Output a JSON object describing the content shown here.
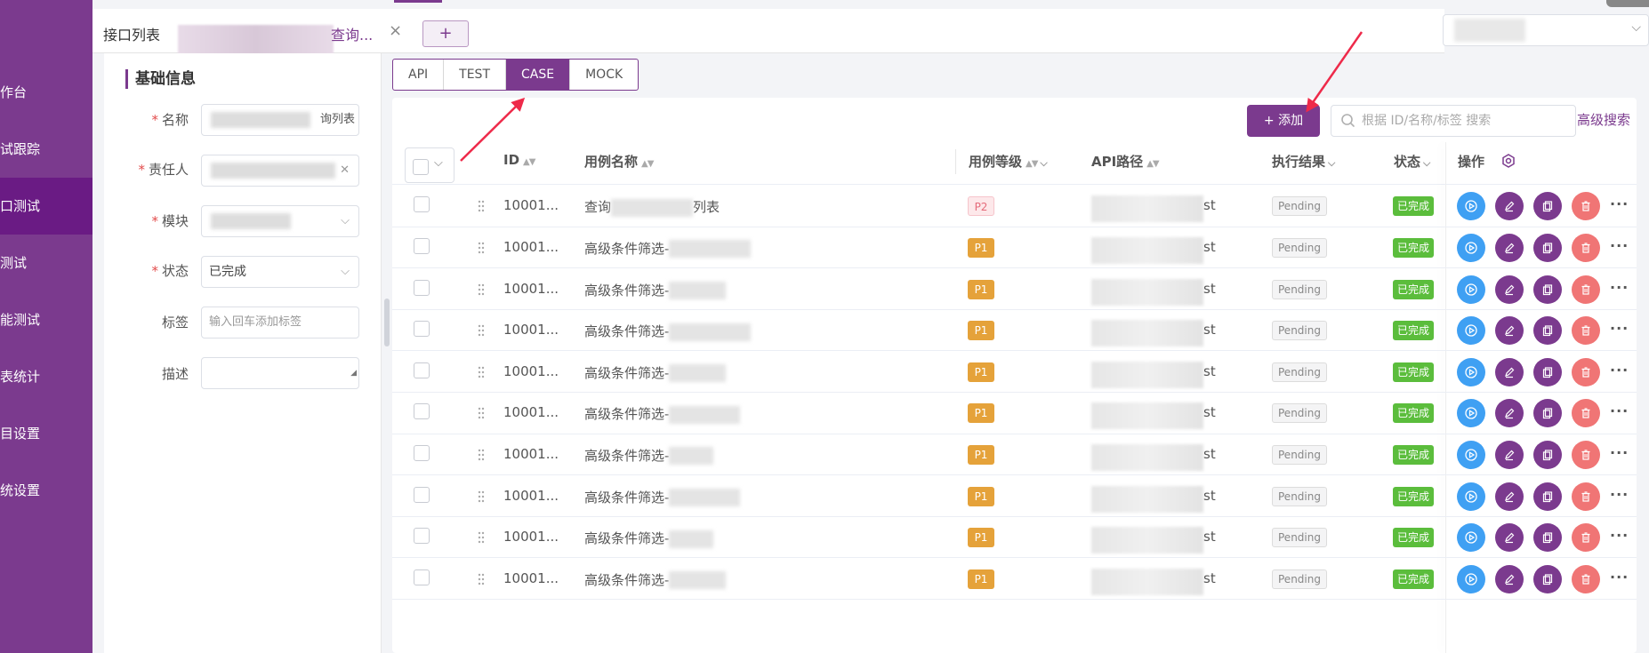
{
  "sidebar": {
    "items": [
      {
        "label": "作台",
        "active": false
      },
      {
        "label": "试跟踪",
        "active": false
      },
      {
        "label": "口测试",
        "active": true
      },
      {
        "label": "测试",
        "active": false
      },
      {
        "label": "能测试",
        "active": false
      },
      {
        "label": "表统计",
        "active": false
      },
      {
        "label": "目设置",
        "active": false
      },
      {
        "label": "统设置",
        "active": false
      }
    ]
  },
  "tabs": {
    "main_label": "接口列表",
    "active_label": "查询...",
    "close_glyph": "×",
    "add_glyph": "+"
  },
  "form": {
    "section_title": "基础信息",
    "fields": {
      "name": {
        "label": "名称",
        "value_suffix": "询列表"
      },
      "owner": {
        "label": "责任人"
      },
      "module": {
        "label": "模块"
      },
      "status": {
        "label": "状态",
        "value": "已完成"
      },
      "tags": {
        "label": "标签",
        "placeholder": "输入回车添加标签"
      },
      "description": {
        "label": "描述",
        "value": ""
      }
    },
    "required_mark": "*"
  },
  "mode_tabs": [
    {
      "label": "API",
      "active": false
    },
    {
      "label": "TEST",
      "active": false
    },
    {
      "label": "CASE",
      "active": true
    },
    {
      "label": "MOCK",
      "active": false
    }
  ],
  "toolbar": {
    "add_label": "+ 添加",
    "search_placeholder": "根据 ID/名称/标签 搜索",
    "advanced_search": "高级搜索"
  },
  "table": {
    "headers": {
      "id": "ID",
      "name": "用例名称",
      "level": "用例等级",
      "api_path": "API路径",
      "result": "执行结果",
      "status": "状态",
      "actions": "操作"
    },
    "rows": [
      {
        "id": "10001...",
        "name_prefix": "查询",
        "name_suffix": "列表",
        "level": "P2",
        "path_suffix": "st",
        "result": "Pending",
        "status": "已完成"
      },
      {
        "id": "10001...",
        "name_prefix": "高级条件筛选-",
        "name_suffix": "",
        "level": "P1",
        "path_suffix": "st",
        "result": "Pending",
        "status": "已完成"
      },
      {
        "id": "10001...",
        "name_prefix": "高级条件筛选-",
        "name_suffix": "",
        "level": "P1",
        "path_suffix": "st",
        "result": "Pending",
        "status": "已完成"
      },
      {
        "id": "10001...",
        "name_prefix": "高级条件筛选-",
        "name_suffix": "",
        "level": "P1",
        "path_suffix": "st",
        "result": "Pending",
        "status": "已完成"
      },
      {
        "id": "10001...",
        "name_prefix": "高级条件筛选-",
        "name_suffix": "",
        "level": "P1",
        "path_suffix": "st",
        "result": "Pending",
        "status": "已完成"
      },
      {
        "id": "10001...",
        "name_prefix": "高级条件筛选-",
        "name_suffix": "",
        "level": "P1",
        "path_suffix": "st",
        "result": "Pending",
        "status": "已完成"
      },
      {
        "id": "10001...",
        "name_prefix": "高级条件筛选-",
        "name_suffix": "",
        "level": "P1",
        "path_suffix": "st",
        "result": "Pending",
        "status": "已完成"
      },
      {
        "id": "10001...",
        "name_prefix": "高级条件筛选-",
        "name_suffix": "",
        "level": "P1",
        "path_suffix": "st",
        "result": "Pending",
        "status": "已完成"
      },
      {
        "id": "10001...",
        "name_prefix": "高级条件筛选-",
        "name_suffix": "",
        "level": "P1",
        "path_suffix": "st",
        "result": "Pending",
        "status": "已完成"
      },
      {
        "id": "10001...",
        "name_prefix": "高级条件筛选-",
        "name_suffix": "",
        "level": "P1",
        "path_suffix": "st",
        "result": "Pending",
        "status": "已完成"
      }
    ]
  },
  "colors": {
    "brand": "#7b3a8e",
    "run": "#3fa0f3",
    "delete": "#f07575",
    "done": "#5bbd3c",
    "p1": "#e5a23a",
    "arrow": "#ee2a4a"
  },
  "icons": {
    "search": "search-icon",
    "settings": "settings-icon",
    "run": "play-icon",
    "edit": "edit-icon",
    "copy": "copy-icon",
    "delete": "trash-icon",
    "more": "more-icon",
    "drag": "drag-handle-icon"
  }
}
